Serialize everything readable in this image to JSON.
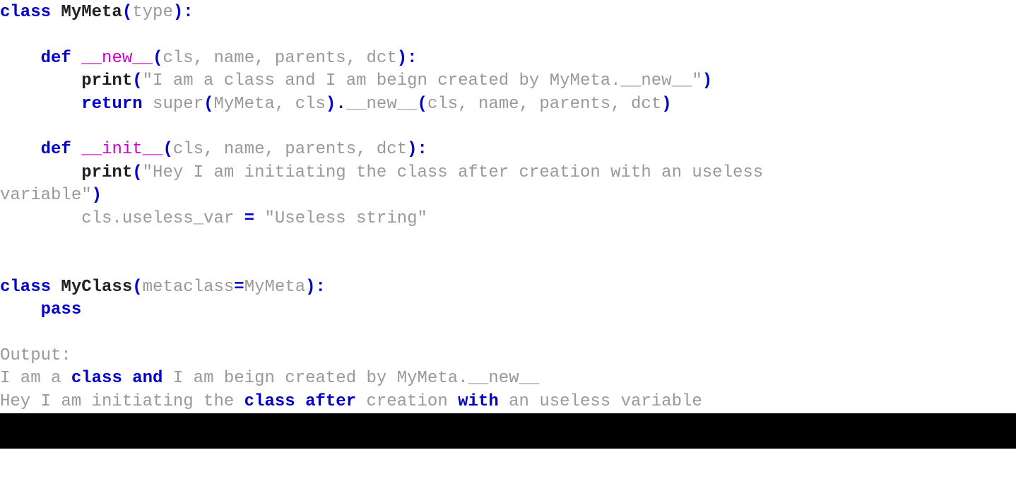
{
  "kw_class": "class",
  "kw_def": "def",
  "kw_return": "return",
  "kw_pass": "pass",
  "kw_and": "and",
  "kw_after": "after",
  "kw_with": "with",
  "name_MyMeta": "MyMeta",
  "name_MyClass": "MyClass",
  "dunder_new": "__new__",
  "dunder_init": "__init__",
  "id_type": "type",
  "id_print": "print",
  "id_super": "super",
  "id_metaclass": "metaclass",
  "params_new": "cls, name, parents, dct",
  "params_init": "cls, name, parents, dct",
  "str_new": "\"I am a class and I am beign created by MyMeta.__new__\"",
  "str_init_a": "\"Hey I am initiating the class after creation with an useless ",
  "str_init_b": "variable\"",
  "assign_target": "cls.useless_var",
  "assign_value": "\"Useless string\"",
  "super_args": "MyMeta, cls",
  "super_call_args": "cls, name, parents, dct",
  "out_label": "Output:",
  "out1_a": "I am a ",
  "out1_b": " I am beign created by MyMeta.__new__",
  "out2_a": "Hey I am initiating the ",
  "out2_b": " creation ",
  "out2_c": " an useless variable",
  "sp": " "
}
